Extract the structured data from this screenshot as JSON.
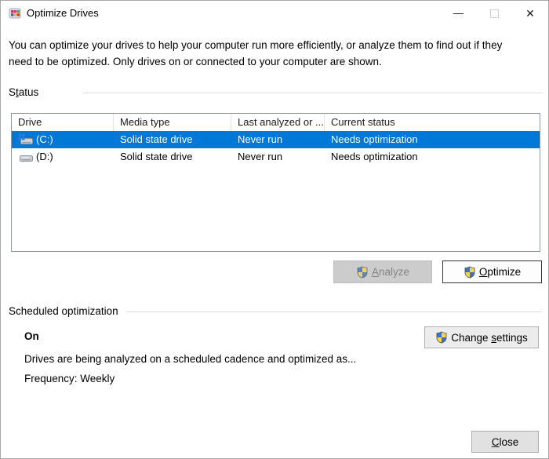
{
  "window": {
    "title": "Optimize Drives",
    "controls": {
      "close_glyph": "✕"
    }
  },
  "description": "You can optimize your drives to help your computer run more efficiently, or analyze them to find out if they need to be optimized. Only drives on or connected to your computer are shown.",
  "sections": {
    "status": {
      "pre": "S",
      "key": "t",
      "post": "atus"
    },
    "scheduled": {
      "label": "Scheduled optimization"
    }
  },
  "table": {
    "headers": [
      {
        "label": "Drive"
      },
      {
        "label": "Media type"
      },
      {
        "label": "Last analyzed or ..."
      },
      {
        "label": "Current status"
      }
    ],
    "rows": [
      {
        "drive": "(C:)",
        "media_type": "Solid state drive",
        "last_analyzed": "Never run",
        "current_status": "Needs optimization",
        "selected": true,
        "icon": "system-drive-icon"
      },
      {
        "drive": "(D:)",
        "media_type": "Solid state drive",
        "last_analyzed": "Never run",
        "current_status": "Needs optimization",
        "selected": false,
        "icon": "drive-icon"
      }
    ]
  },
  "buttons": {
    "analyze": {
      "pre": "",
      "key": "A",
      "post": "nalyze",
      "disabled": true
    },
    "optimize": {
      "pre": "",
      "key": "O",
      "post": "ptimize"
    },
    "change_settings": {
      "pre": "Change ",
      "key": "s",
      "post": "ettings"
    },
    "close": {
      "pre": "",
      "key": "C",
      "post": "lose"
    }
  },
  "scheduled": {
    "state": "On",
    "detail": "Drives are being analyzed on a scheduled cadence and optimized as...",
    "frequency": "Frequency: Weekly"
  },
  "colors": {
    "selection": "#0078d7",
    "shield_blue": "#3a73c2",
    "shield_yellow": "#fbd44c"
  }
}
